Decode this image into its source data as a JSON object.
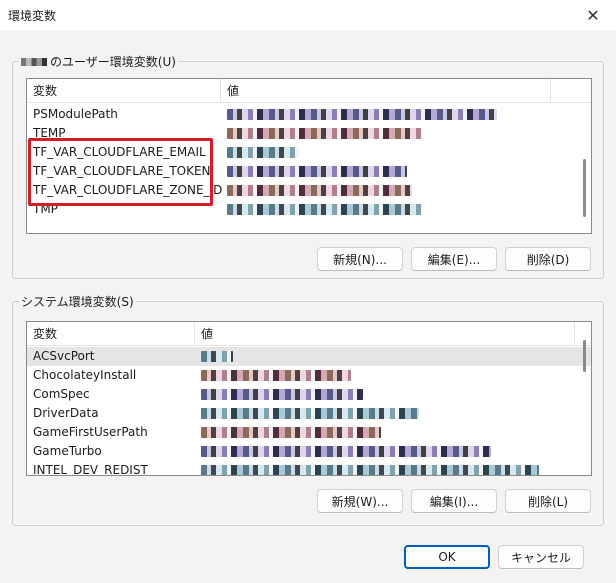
{
  "window": {
    "title": "環境変数",
    "close_glyph": "✕"
  },
  "user_vars": {
    "group_label": "のユーザー環境変数(U)",
    "headers": {
      "name": "変数",
      "value": "値"
    },
    "rows": [
      {
        "name": "PSModulePath"
      },
      {
        "name": "TEMP"
      },
      {
        "name": "TF_VAR_CLOUDFLARE_EMAIL"
      },
      {
        "name": "TF_VAR_CLOUDFLARE_TOKEN"
      },
      {
        "name": "TF_VAR_CLOUDFLARE_ZONE_ID"
      },
      {
        "name": "TMP"
      }
    ],
    "buttons": {
      "new": "新規(N)...",
      "edit": "編集(E)...",
      "delete": "削除(D)"
    }
  },
  "system_vars": {
    "group_label": "システム環境変数(S)",
    "headers": {
      "name": "変数",
      "value": "値"
    },
    "rows": [
      {
        "name": "ACSvcPort"
      },
      {
        "name": "ChocolateyInstall"
      },
      {
        "name": "ComSpec"
      },
      {
        "name": "DriverData"
      },
      {
        "name": "GameFirstUserPath"
      },
      {
        "name": "GameTurbo"
      },
      {
        "name": "INTEL_DEV_REDIST"
      }
    ],
    "buttons": {
      "new": "新規(W)...",
      "edit": "編集(I)...",
      "delete": "削除(L)"
    }
  },
  "footer": {
    "ok": "OK",
    "cancel": "キャンセル"
  },
  "colors": {
    "highlight_border": "#d21f2b",
    "primary_button_border": "#005fb8",
    "selected_row": "#e5e5e5"
  }
}
